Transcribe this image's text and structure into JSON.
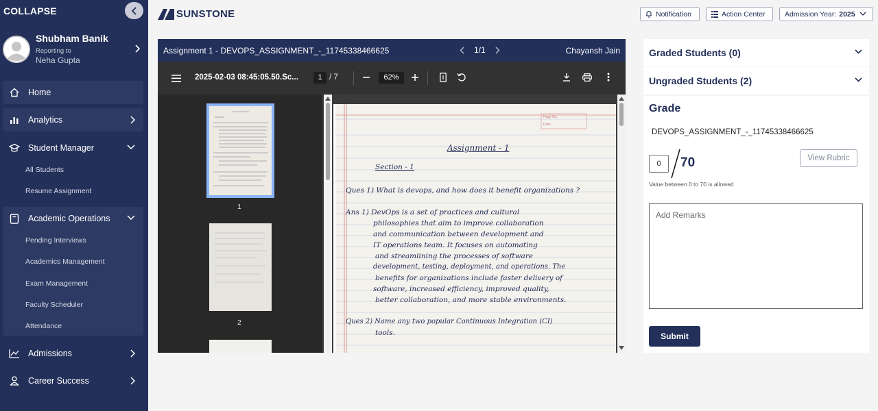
{
  "sidebar": {
    "collapse_label": "COLLAPSE",
    "profile": {
      "name": "Shubham Banik",
      "reporting_label": "Reporting to",
      "manager": "Neha Gupta"
    },
    "items": {
      "home": "Home",
      "analytics": "Analytics",
      "student_manager": "Student Manager",
      "all_students": "All Students",
      "resume_assignment": "Resume Assignment",
      "academic_operations": "Academic Operations",
      "pending_interviews": "Pending Interviews",
      "academics_management": "Academics Management",
      "exam_management": "Exam Management",
      "faculty_scheduler": "Faculty Scheduler",
      "attendance": "Attendance",
      "admissions": "Admissions",
      "career_success": "Career Success"
    }
  },
  "header": {
    "logo_text": "SUNSTONE",
    "notification": "Notification",
    "action_center": "Action Center",
    "admission_year_label": "Admission Year:",
    "admission_year_value": "2025"
  },
  "viewer": {
    "title": "Assignment 1 - DEVOPS_ASSIGNMENT_-_11745338466625",
    "pager": "1/1",
    "student": "Chayansh Jain",
    "file_name": "2025-02-03 08:45:05.50.Sc...",
    "page_current": "1",
    "page_total": "/  7",
    "zoom": "62%",
    "thumbnails": [
      "1",
      "2"
    ],
    "page": {
      "heading": "Assignment - 1",
      "section": "Section - 1",
      "lines": [
        "Ques 1)  What is devops, and how does it benefit organizations ?",
        "Ans 1)  DevOps is a set of practices and cultural",
        "philosophies that aim to improve collaboration",
        "and communication between development and",
        "IT operations team. It focuses on automating",
        "and streamlining the processes of software",
        "development, testing, deployment, and operations. The",
        "benefits for organizations include faster delivery of",
        "software, increased efficiency, improved quality,",
        "better collaboration, and more stable environments.",
        "Ques 2)  Name any two popular Continuous Integration (CI)",
        "tools."
      ],
      "page_no_label": "Page No.",
      "date_label": "Date"
    }
  },
  "panel": {
    "graded": "Graded Students (0)",
    "ungraded": "Ungraded Students (2)",
    "grade_title": "Grade",
    "assignment_name": "DEVOPS_ASSIGNMENT_-_11745338466625",
    "score_value": "0",
    "score_max": "70",
    "hint": "Value between 0 to 70 is allowed",
    "view_rubric": "View Rubric",
    "remarks_placeholder": "Add Remarks",
    "submit": "Submit"
  },
  "colors": {
    "navy": "#23305a",
    "nav_active": "#2d3a64",
    "thumb_select": "#8ab4f8"
  }
}
